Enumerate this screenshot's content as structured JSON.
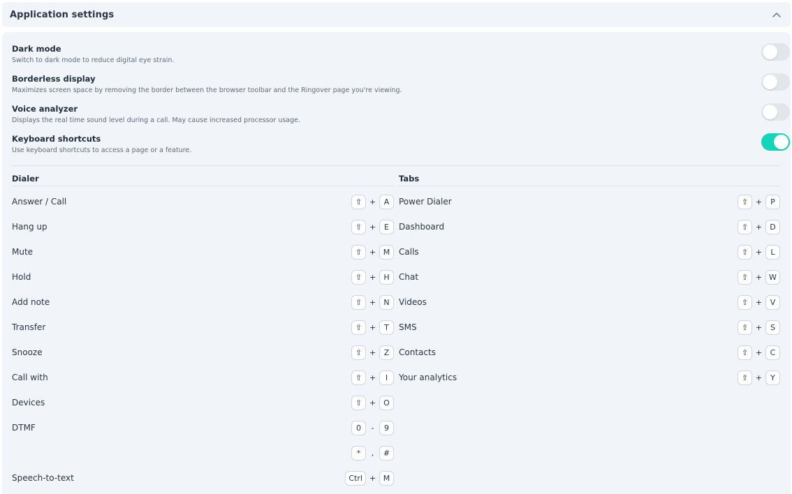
{
  "header": {
    "title": "Application settings",
    "collapse_icon": "chevron-up-icon"
  },
  "settings": [
    {
      "title": "Dark mode",
      "description": "Switch to dark mode to reduce digital eye strain.",
      "enabled": false
    },
    {
      "title": "Borderless display",
      "description": "Maximizes screen space by removing the border between the browser toolbar and the Ringover page you're viewing.",
      "enabled": false
    },
    {
      "title": "Voice analyzer",
      "description": "Displays the real time sound level during a call. May cause increased processor usage.",
      "enabled": false
    },
    {
      "title": "Keyboard shortcuts",
      "description": "Use keyboard shortcuts to access a page or a feature.",
      "enabled": true
    }
  ],
  "toggle_color_on": "#12d6b8",
  "toggle_color_off": "#e2e5ea",
  "shift_symbol": "⇧",
  "dialer": {
    "heading": "Dialer",
    "rows": [
      {
        "label": "Answer / Call",
        "keys": [
          "⇧",
          "+",
          "A"
        ]
      },
      {
        "label": "Hang up",
        "keys": [
          "⇧",
          "+",
          "E"
        ]
      },
      {
        "label": "Mute",
        "keys": [
          "⇧",
          "+",
          "M"
        ]
      },
      {
        "label": "Hold",
        "keys": [
          "⇧",
          "+",
          "H"
        ]
      },
      {
        "label": "Add note",
        "keys": [
          "⇧",
          "+",
          "N"
        ]
      },
      {
        "label": "Transfer",
        "keys": [
          "⇧",
          "+",
          "T"
        ]
      },
      {
        "label": "Snooze",
        "keys": [
          "⇧",
          "+",
          "Z"
        ]
      },
      {
        "label": "Call with",
        "keys": [
          "⇧",
          "+",
          "I"
        ]
      },
      {
        "label": "Devices",
        "keys": [
          "⇧",
          "+",
          "O"
        ]
      },
      {
        "label": "DTMF",
        "keys": [
          "0",
          "-",
          "9"
        ]
      },
      {
        "label": "",
        "keys": [
          "*",
          ",",
          "#"
        ]
      },
      {
        "label": "Speech-to-text",
        "keys": [
          "Ctrl",
          "+",
          "M"
        ]
      }
    ]
  },
  "tabs": {
    "heading": "Tabs",
    "rows": [
      {
        "label": "Power Dialer",
        "keys": [
          "⇧",
          "+",
          "P"
        ]
      },
      {
        "label": "Dashboard",
        "keys": [
          "⇧",
          "+",
          "D"
        ]
      },
      {
        "label": "Calls",
        "keys": [
          "⇧",
          "+",
          "L"
        ]
      },
      {
        "label": "Chat",
        "keys": [
          "⇧",
          "+",
          "W"
        ]
      },
      {
        "label": "Videos",
        "keys": [
          "⇧",
          "+",
          "V"
        ]
      },
      {
        "label": "SMS",
        "keys": [
          "⇧",
          "+",
          "S"
        ]
      },
      {
        "label": "Contacts",
        "keys": [
          "⇧",
          "+",
          "C"
        ]
      },
      {
        "label": "Your analytics",
        "keys": [
          "⇧",
          "+",
          "Y"
        ]
      }
    ]
  }
}
